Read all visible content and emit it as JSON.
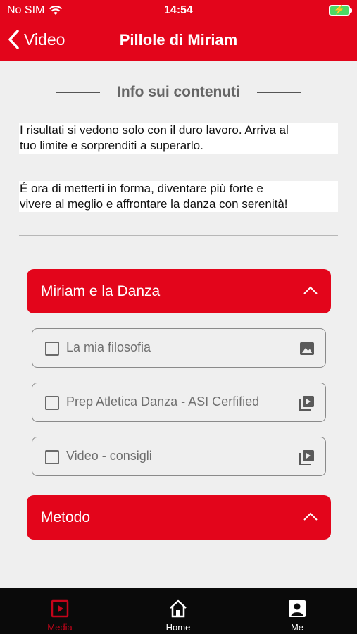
{
  "status_bar": {
    "carrier": "No SIM",
    "time": "14:54",
    "battery_icon": "charging-battery-icon"
  },
  "nav": {
    "back_label": "Video",
    "title": "Pillole di Miriam"
  },
  "info": {
    "heading": "Info sui contenuti",
    "paragraph_1_line_1": "I risultati si vedono solo con il duro lavoro. Arriva al",
    "paragraph_1_line_2": "tuo limite e sorprenditi a superarlo.",
    "paragraph_2_line_1": "É ora di metterti in forma, diventare più forte e",
    "paragraph_2_line_2": "vivere al meglio e affrontare la danza con serenità!"
  },
  "sections": [
    {
      "title": "Miriam e la Danza",
      "expanded": true,
      "items": [
        {
          "label": "La mia filosofia",
          "checked": false,
          "type_icon": "image-icon"
        },
        {
          "label": "Prep Atletica Danza - ASI Cerfified",
          "checked": false,
          "type_icon": "video-library-icon"
        },
        {
          "label": "Video - consigli",
          "checked": false,
          "type_icon": "video-library-icon"
        }
      ]
    },
    {
      "title": "Metodo",
      "expanded": false,
      "items": []
    }
  ],
  "tabbar": {
    "tabs": [
      {
        "label": "Media",
        "icon": "play-square-icon",
        "active": true
      },
      {
        "label": "Home",
        "icon": "home-icon",
        "active": false
      },
      {
        "label": "Me",
        "icon": "profile-icon",
        "active": false
      }
    ]
  },
  "colors": {
    "brand_red": "#e3051b",
    "background": "#efefef",
    "tabbar": "#0a0a0a",
    "active_tab": "#c4041a"
  }
}
